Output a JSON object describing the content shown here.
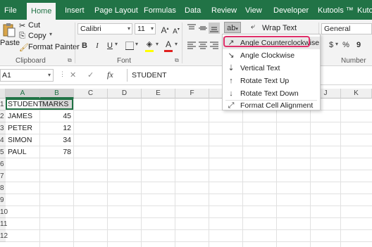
{
  "tabs": [
    "File",
    "Home",
    "Insert",
    "Page Layout",
    "Formulas",
    "Data",
    "Review",
    "View",
    "Developer",
    "Kutools ™",
    "Kutools"
  ],
  "clipboard": {
    "paste": "Paste",
    "cut": "Cut",
    "copy": "Copy",
    "format_painter": "Format Painter",
    "group": "Clipboard"
  },
  "font": {
    "name": "Calibri",
    "size": "11",
    "grow": "A",
    "shrink": "A",
    "bold": "B",
    "italic": "I",
    "underline": "U",
    "color_letter": "A",
    "group": "Font"
  },
  "alignment": {
    "wrap_text": "Wrap Text"
  },
  "number": {
    "format": "General",
    "currency": "$",
    "percent": "%",
    "comma": "9",
    "group": "Number"
  },
  "formula_bar": {
    "name_box": "A1",
    "fx": "fx",
    "content": "STUDENT"
  },
  "columns": [
    "A",
    "B",
    "C",
    "D",
    "E",
    "F",
    "G",
    "H",
    "I",
    "J",
    "K"
  ],
  "rows": [
    "1",
    "2",
    "3",
    "4",
    "5",
    "6",
    "7",
    "8",
    "9",
    "10",
    "11",
    "12"
  ],
  "cells": {
    "headers": [
      "STUDENT",
      "MARKS"
    ],
    "data": [
      {
        "name": "JAMES",
        "marks": "45"
      },
      {
        "name": "PETER",
        "marks": "12"
      },
      {
        "name": "SIMON",
        "marks": "34"
      },
      {
        "name": "PAUL",
        "marks": "78"
      }
    ]
  },
  "orientation_menu": {
    "items": [
      {
        "label": "Angle Counterclockwise",
        "icon": "angle-counterclockwise-icon"
      },
      {
        "label": "Angle Clockwise",
        "icon": "angle-clockwise-icon"
      },
      {
        "label": "Vertical Text",
        "icon": "vertical-text-icon"
      },
      {
        "label": "Rotate Text Up",
        "icon": "rotate-text-up-icon"
      },
      {
        "label": "Rotate Text Down",
        "icon": "rotate-text-down-icon"
      },
      {
        "label": "Format Cell Alignment",
        "icon": "format-cell-alignment-icon"
      }
    ]
  },
  "colors": {
    "ribbon_green": "#217346",
    "highlight_ring": "#e0306a",
    "font_color_red": "#e0201e",
    "fill_yellow": "#ffff00"
  }
}
